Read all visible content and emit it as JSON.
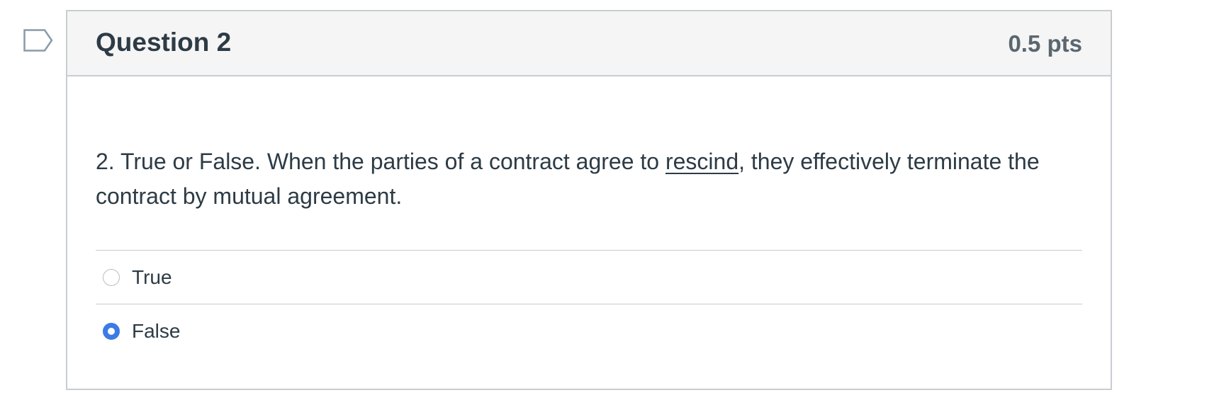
{
  "question": {
    "title": "Question 2",
    "points": "0.5 pts",
    "text_before": "2. True or False. When the parties of a contract agree to ",
    "text_underlined": "rescind",
    "text_after": ", they effectively terminate the contract by mutual agreement.",
    "answers": [
      {
        "label": "True",
        "selected": false
      },
      {
        "label": "False",
        "selected": true
      }
    ]
  },
  "icons": {
    "flag": "bookmark-flag-icon"
  },
  "colors": {
    "accent": "#3b7be6",
    "text": "#2d3b45",
    "points_text": "#5b6770",
    "border": "#c7cdd1",
    "header_bg": "#f5f5f5",
    "flag_stroke": "#8a9ba8"
  }
}
